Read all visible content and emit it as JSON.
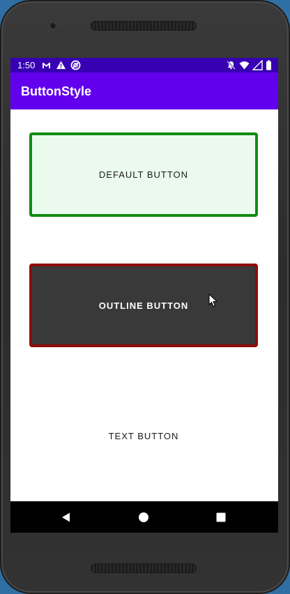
{
  "status_bar": {
    "time": "1:50",
    "left_icons": [
      "gmail-icon",
      "warning-icon",
      "sync-icon"
    ],
    "right_icons": [
      "mute-icon",
      "wifi-icon",
      "signal-icon",
      "battery-icon"
    ],
    "background": "#3700b3"
  },
  "app_bar": {
    "title": "ButtonStyle",
    "background": "#6200ee"
  },
  "buttons": {
    "default_label": "DEFAULT BUTTON",
    "outline_label": "OUTLINE BUTTON",
    "text_label": "TEXT BUTTON"
  },
  "colors": {
    "default_border": "#0f8d0f",
    "default_fill": "#eafbee",
    "outline_border": "#8f0b0b",
    "outline_fill": "#393939"
  },
  "nav_bar": {
    "icons": [
      "back-icon",
      "home-icon",
      "recents-icon"
    ]
  }
}
